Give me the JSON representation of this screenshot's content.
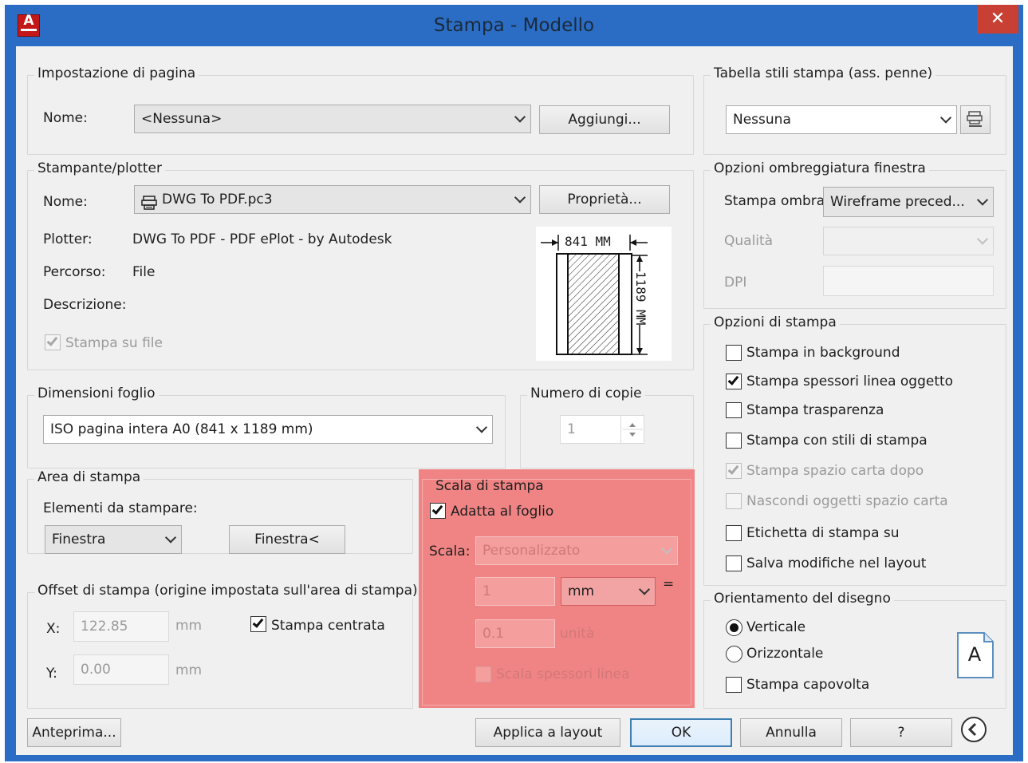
{
  "window": {
    "title": "Stampa - Modello",
    "close_glyph": "✕",
    "app_icon_letter": "A"
  },
  "page_setup": {
    "title": "Impostazione di pagina",
    "name_label": "Nome:",
    "name_value": "<Nessuna>",
    "add_button": "Aggiungi..."
  },
  "printer": {
    "title": "Stampante/plotter",
    "name_label": "Nome:",
    "name_value": "DWG To PDF.pc3",
    "props_button": "Proprietà...",
    "plotter_label": "Plotter:",
    "plotter_value": "DWG To PDF - PDF ePlot - by Autodesk",
    "path_label": "Percorso:",
    "path_value": "File",
    "desc_label": "Descrizione:",
    "print_to_file": "Stampa su file",
    "preview_width": "841  MM",
    "preview_height": "1189  MM"
  },
  "paper_size": {
    "title": "Dimensioni foglio",
    "value": "ISO pagina intera A0 (841 x 1189 mm)"
  },
  "copies": {
    "title": "Numero di copie",
    "value": "1"
  },
  "print_area": {
    "title": "Area di stampa",
    "what_label": "Elementi da stampare:",
    "what_value": "Finestra",
    "window_button": "Finestra<"
  },
  "offset": {
    "title": "Offset di stampa (origine impostata sull'area di stampa)",
    "x_label": "X:",
    "x_value": "122.85",
    "x_unit": "mm",
    "y_label": "Y:",
    "y_value": "0.00",
    "y_unit": "mm",
    "center": "Stampa centrata"
  },
  "scale": {
    "title": "Scala di stampa",
    "fit": "Adatta al foglio",
    "scale_label": "Scala:",
    "scale_value": "Personalizzato",
    "value1": "1",
    "unit1": "mm",
    "equals": "=",
    "value2": "0.1",
    "unit2": "unità",
    "lineweights": "Scala spessori linea"
  },
  "style_table": {
    "title": "Tabella stili stampa (ass. penne)",
    "value": "Nessuna"
  },
  "shaded": {
    "title": "Opzioni ombreggiatura finestra",
    "shade_label": "Stampa ombra",
    "shade_value": "Wireframe preced...",
    "quality_label": "Qualità",
    "dpi_label": "DPI"
  },
  "options": {
    "title": "Opzioni di stampa",
    "items": [
      "Stampa in background",
      "Stampa spessori linea oggetto",
      "Stampa trasparenza",
      "Stampa con stili di stampa",
      "Stampa spazio carta dopo",
      "Nascondi oggetti spazio carta",
      "Etichetta di stampa su",
      "Salva modifiche nel layout"
    ]
  },
  "orientation": {
    "title": "Orientamento del disegno",
    "portrait": "Verticale",
    "landscape": "Orizzontale",
    "upside_down": "Stampa capovolta",
    "icon_letter": "A"
  },
  "footer": {
    "preview": "Anteprima...",
    "apply": "Applica a layout",
    "ok": "OK",
    "cancel": "Annulla",
    "help": "?"
  },
  "colors": {
    "title_bar": "#2b6dc4",
    "close": "#c74033",
    "highlight": "#f05a5a",
    "dialog_bg": "#f0f0f0"
  }
}
